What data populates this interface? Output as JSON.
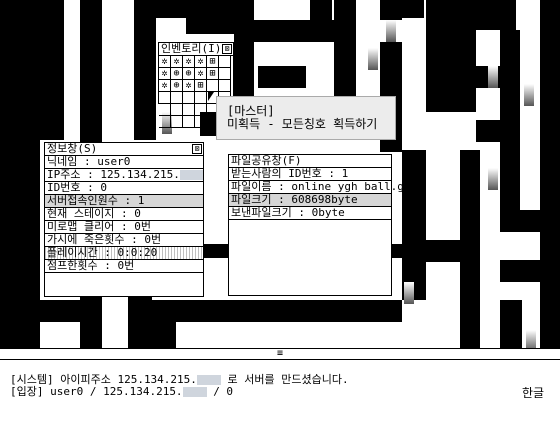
{
  "inventory": {
    "title": "인벤토리(I)",
    "close": "⊠",
    "slots": [
      "✲",
      "✲",
      "✲",
      "✲",
      "⊞",
      "",
      "✲",
      "⊕",
      "⊕",
      "✲",
      "⊞",
      "",
      "✲",
      "⊕",
      "✲",
      "⊞",
      "",
      "",
      "",
      "",
      "",
      "",
      "",
      "",
      "",
      "",
      "",
      "",
      "",
      "",
      "",
      "",
      "",
      "",
      "",
      ""
    ]
  },
  "tooltip": {
    "name": "[마스터]",
    "desc": "미획득 - 모든칭호 획득하기"
  },
  "info": {
    "title": "정보창(S)",
    "close": "⊠",
    "rows": [
      "닉네임 : user0",
      "IP주소 : 125.134.215.",
      "ID번호 : 0",
      "서버접속인원수 : 1",
      "현재 스테이지 : 0",
      "미로맵 클리어 : 0번",
      "가시에 죽은횟수 : 0번",
      "플레이시간 : 0:0:20",
      "점프한횟수 : 0번",
      ""
    ]
  },
  "fileshare": {
    "title": "파일공유창(F)",
    "rows": [
      "받는사람의 ID번호 : 1",
      "파일이름 : online ygh ball.gmk",
      "파일크기 : 608698byte",
      "보낸파일크기 : 0byte"
    ]
  },
  "chat": {
    "grip": "≡",
    "line1": "[시스템] 아이피주소 125.134.215.",
    "line1_tail": "로 서버를 만드셨습니다.",
    "line2": "[입장] user0 / 125.134.215.",
    "line2_tail": "/ 0",
    "ime": "한글"
  },
  "arrow_glyph": "⬆"
}
